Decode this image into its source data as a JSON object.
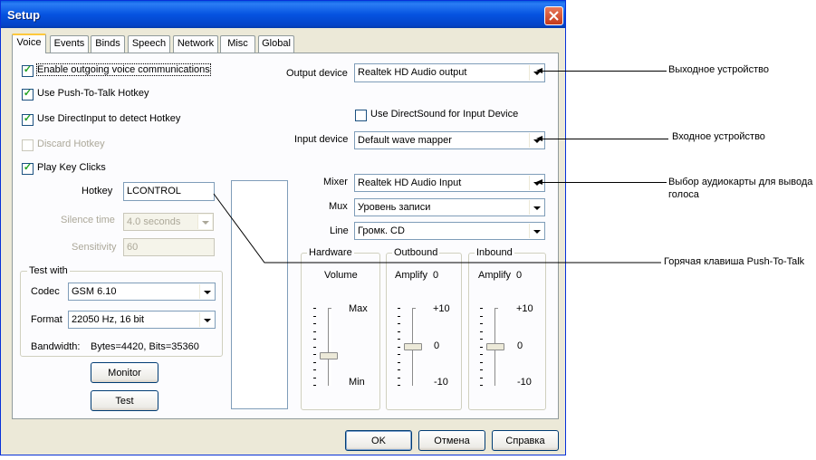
{
  "window": {
    "title": "Setup"
  },
  "tabs": [
    {
      "label": "Voice",
      "active": true
    },
    {
      "label": "Events"
    },
    {
      "label": "Binds"
    },
    {
      "label": "Speech"
    },
    {
      "label": "Network"
    },
    {
      "label": "Misc"
    },
    {
      "label": "Global"
    }
  ],
  "voice": {
    "checkboxes": {
      "enable_outgoing": {
        "label": "Enable outgoing voice communications",
        "checked": true
      },
      "push_to_talk": {
        "label": "Use Push-To-Talk Hotkey",
        "checked": true
      },
      "directinput": {
        "label": "Use DirectInput to detect Hotkey",
        "checked": true
      },
      "discard_hotkey": {
        "label": "Discard Hotkey",
        "checked": false,
        "disabled": true
      },
      "play_key_clicks": {
        "label": "Play Key Clicks",
        "checked": true
      }
    },
    "hotkey": {
      "label": "Hotkey",
      "value": "LCONTROL"
    },
    "silence_time": {
      "label": "Silence time",
      "value": "4.0 seconds"
    },
    "sensitivity": {
      "label": "Sensitivity",
      "value": "60"
    },
    "test_with": {
      "title": "Test with",
      "codec_label": "Codec",
      "codec_value": "GSM 6.10",
      "format_label": "Format",
      "format_value": "22050 Hz, 16 bit",
      "bandwidth_label": "Bandwidth:",
      "bandwidth_value": "Bytes=4420, Bits=35360"
    },
    "buttons": {
      "monitor": "Monitor",
      "test": "Test"
    },
    "output_device": {
      "label": "Output device",
      "value": "Realtek HD Audio output"
    },
    "use_directsound": {
      "label": "Use DirectSound for Input Device",
      "checked": false
    },
    "input_device": {
      "label": "Input device",
      "value": "Default wave mapper"
    },
    "mixer": {
      "label": "Mixer",
      "value": "Realtek HD Audio Input"
    },
    "mux": {
      "label": "Mux",
      "value": "Уровень записи"
    },
    "line": {
      "label": "Line",
      "value": "Громк. CD"
    },
    "hardware": {
      "title": "Hardware",
      "caption": "Volume",
      "max": "Max",
      "min": "Min",
      "level": 0.62
    },
    "outbound": {
      "title": "Outbound",
      "caption": "Amplify",
      "value": "0",
      "top": "+10",
      "mid": "0",
      "bottom": "-10",
      "level": 0.5
    },
    "inbound": {
      "title": "Inbound",
      "caption": "Amplify",
      "value": "0",
      "top": "+10",
      "mid": "0",
      "bottom": "-10",
      "level": 0.5
    }
  },
  "dialog_buttons": {
    "ok": "OK",
    "cancel": "Отмена",
    "help": "Справка"
  },
  "annotations": {
    "output": "Выходное устройство",
    "input": "Входное устройство",
    "mixer": "Выбор аудиокарты для вывода голоса",
    "hotkey": "Горячая клавиша Push-To-Talk"
  },
  "colors": {
    "titlebar": "#0553e0",
    "window_bg": "#ece9d8",
    "tab_highlight": "#ffc83c",
    "check": "#21a121"
  }
}
